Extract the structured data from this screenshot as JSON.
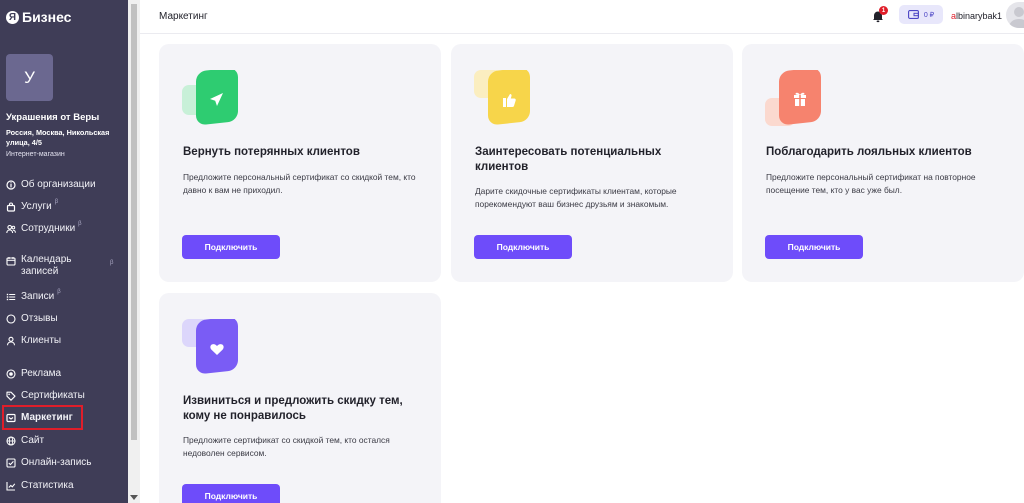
{
  "brand": {
    "logo_letter": "Я",
    "name": "Бизнес"
  },
  "organization": {
    "avatar_letter": "У",
    "name": "Украшения от Веры",
    "address": "Россия, Москва, Никольская улица, 4/5",
    "type": "Интернет-магазин"
  },
  "sidebar": {
    "items": [
      {
        "label": "Об организации",
        "icon": "info-circle-icon",
        "beta": ""
      },
      {
        "label": "Услуги",
        "icon": "bag-icon",
        "beta": "β"
      },
      {
        "label": "Сотрудники",
        "icon": "people-icon",
        "beta": "β"
      },
      {
        "label": "Календарь записей",
        "icon": "calendar-icon",
        "beta": "β"
      },
      {
        "label": "Записи",
        "icon": "list-icon",
        "beta": "β"
      },
      {
        "label": "Отзывы",
        "icon": "chat-icon",
        "beta": ""
      },
      {
        "label": "Клиенты",
        "icon": "user-icon",
        "beta": ""
      },
      {
        "label": "Реклама",
        "icon": "target-icon",
        "beta": ""
      },
      {
        "label": "Сертификаты",
        "icon": "tag-icon",
        "beta": ""
      },
      {
        "label": "Маркетинг",
        "icon": "megaphone-icon",
        "beta": "",
        "active": true
      },
      {
        "label": "Сайт",
        "icon": "globe-icon",
        "beta": ""
      },
      {
        "label": "Онлайн-запись",
        "icon": "checkbox-icon",
        "beta": ""
      },
      {
        "label": "Статистика",
        "icon": "chart-icon",
        "beta": ""
      }
    ]
  },
  "header": {
    "title": "Маркетинг",
    "notifications_count": "1",
    "balance": "0 ₽",
    "username_first": "a",
    "username_rest": "lbinarybak1"
  },
  "cards": [
    {
      "title": "Вернуть потерянных клиентов",
      "description": "Предложите персональный сертификат со скидкой тем, кто давно к вам не приходил.",
      "button": "Подключить",
      "icon": "paper-plane-icon",
      "color": "#2ecc71",
      "back_color": "#c8f0d8"
    },
    {
      "title": "Заинтересовать потенциальных клиентов",
      "description": "Дарите скидочные сертификаты клиентам, которые порекомендуют ваш бизнес друзьям и знакомым.",
      "button": "Подключить",
      "icon": "thumbs-up-icon",
      "color": "#f7d54a",
      "back_color": "#fbeec0"
    },
    {
      "title": "Поблагодарить лояльных клиентов",
      "description": "Предложите персональный сертификат на повторное посещение тем, кто у вас уже был.",
      "button": "Подключить",
      "icon": "gift-icon",
      "color": "#f6836e",
      "back_color": "#fbd9cf"
    },
    {
      "title": "Извиниться и предложить скидку тем, кому не понравилось",
      "description": "Предложите сертификат со скидкой тем, кто остался недоволен сервисом.",
      "button": "Подключить",
      "icon": "heart-icon",
      "color": "#7a5cf5",
      "back_color": "#dcd6fb"
    }
  ]
}
